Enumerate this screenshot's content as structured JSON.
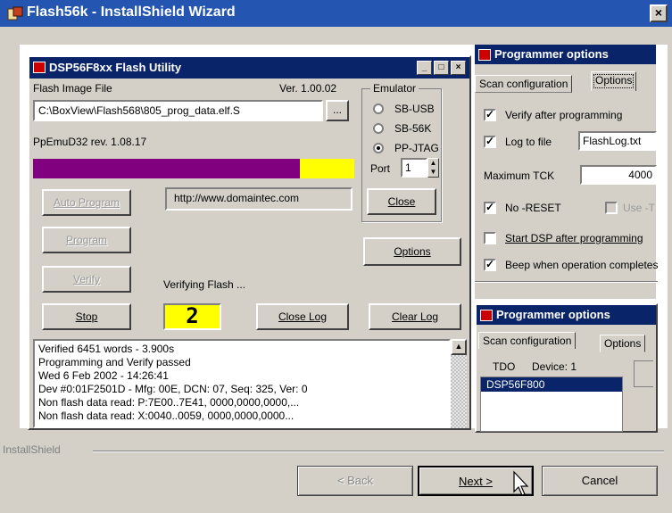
{
  "window": {
    "title": "Flash56k - InstallShield Wizard",
    "close": "×"
  },
  "utility": {
    "title": "DSP56F8xx Flash Utility",
    "flash_image_label": "Flash Image File",
    "version": "Ver. 1.00.02",
    "file_path": "C:\\BoxView\\Flash568\\805_prog_data.elf.S",
    "browse": "...",
    "emulator_info": "PpEmuD32 rev. 1.08.17",
    "progress": 0.83,
    "url": "http://www.domaintec.com",
    "status": "Verifying Flash ...",
    "counter": "2",
    "buttons": {
      "auto_program": "Auto Program",
      "program": "Program",
      "verify": "Verify",
      "stop": "Stop",
      "close_log": "Close Log",
      "clear_log": "Clear Log",
      "options": "Options",
      "close": "Close"
    },
    "emulator": {
      "label": "Emulator",
      "options": [
        "SB-USB",
        "SB-56K",
        "PP-JTAG"
      ],
      "selected": "PP-JTAG",
      "port_label": "Port",
      "port_value": "1"
    },
    "log_lines": [
      "Verified 6451 words - 3.900s",
      "Programming and Verify passed",
      "Wed 6 Feb 2002 - 14:26:41",
      "Dev #0:01F2501D - Mfg: 00E, DCN: 07, Seq: 325, Ver: 0",
      "Non flash data read: P:7E00..7E41, 0000,0000,0000,...",
      "Non flash data read: X:0040..0059, 0000,0000,0000..."
    ]
  },
  "options_back": {
    "title": "Programmer options",
    "tabs": [
      "Scan configuration",
      "Options"
    ],
    "verify": "Verify after programming",
    "log_to_file": "Log to file",
    "log_file": "FlashLog.txt",
    "max_tck_label": "Maximum TCK",
    "max_tck_value": "4000",
    "no_reset": "No -RESET",
    "use_t": "Use -T",
    "start_dsp": "Start DSP after programming",
    "beep": "Beep when operation completes"
  },
  "options_front": {
    "title": "Programmer options",
    "tabs": [
      "Scan configuration",
      "Options"
    ],
    "tdo": "TDO",
    "device": "Device: 1",
    "device_name": "DSP56F800"
  },
  "footer": {
    "brand": "InstallShield",
    "back": "< Back",
    "next": "Next >",
    "cancel": "Cancel"
  }
}
